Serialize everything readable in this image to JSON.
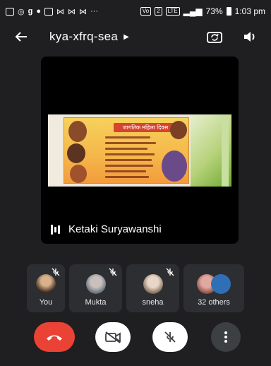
{
  "status_bar": {
    "battery": "73%",
    "time": "1:03 pm",
    "network": "LTE",
    "volte": "VoLTE"
  },
  "header": {
    "meeting_code": "kya-xfrq-sea",
    "icons": [
      "back-arrow-icon",
      "caret-right-icon",
      "switch-camera-icon",
      "speaker-icon"
    ]
  },
  "main": {
    "presenter_name": "Ketaki Suryawanshi",
    "slide_title": "जागतिक महिला दिवस"
  },
  "participants": [
    {
      "name": "You",
      "muted": true
    },
    {
      "name": "Mukta",
      "muted": true
    },
    {
      "name": "sneha",
      "muted": true
    },
    {
      "name": "32 others",
      "muted": false
    }
  ],
  "colors": {
    "background": "#1f1f21",
    "tile": "#2d2e31",
    "end_call": "#ea4335",
    "control_white": "#ffffff",
    "control_dark": "#3c4043"
  },
  "controls": [
    "end-call-icon",
    "camera-off-icon",
    "mic-off-icon",
    "more-options-icon"
  ]
}
